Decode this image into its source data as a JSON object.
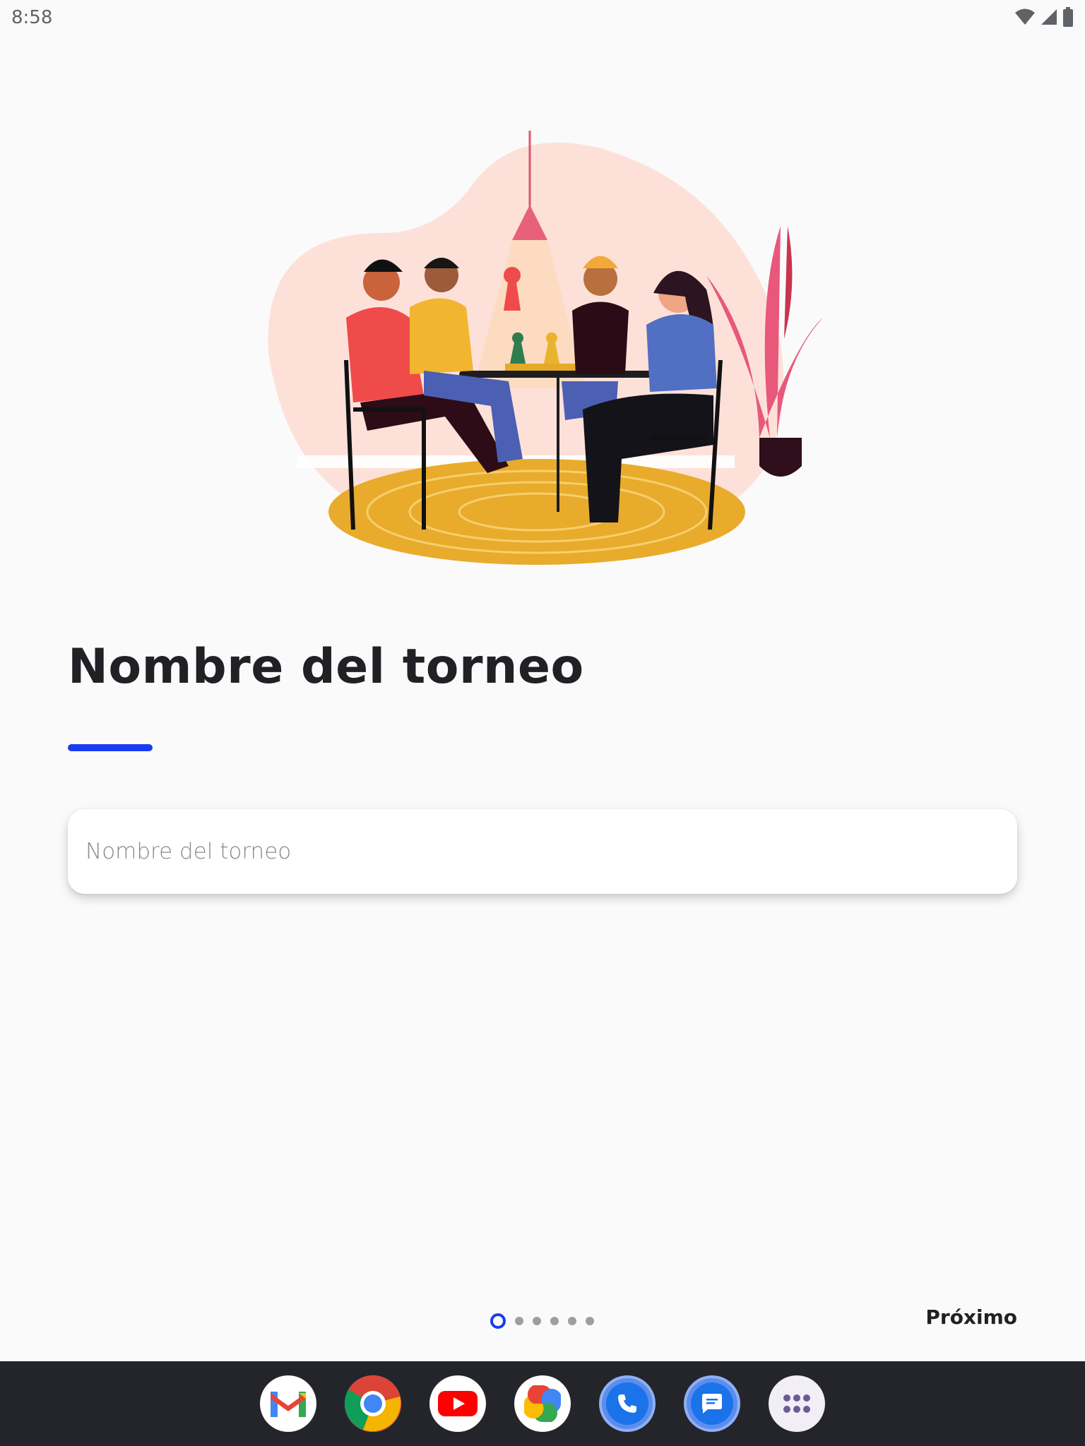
{
  "status_bar": {
    "time": "8:58",
    "icons": [
      "wifi-icon",
      "cellular-signal-icon",
      "battery-icon"
    ]
  },
  "illustration": {
    "description_icon": "people-playing-board-game-illustration"
  },
  "page": {
    "title": "Nombre del torneo",
    "accent_color": "#1a3cf0"
  },
  "input": {
    "placeholder": "Nombre del torneo",
    "value": ""
  },
  "pager": {
    "total": 6,
    "current": 1
  },
  "actions": {
    "next_label": "Próximo"
  },
  "dock": {
    "apps": [
      {
        "name": "Gmail",
        "icon": "gmail-icon"
      },
      {
        "name": "Chrome",
        "icon": "chrome-icon"
      },
      {
        "name": "YouTube",
        "icon": "youtube-icon"
      },
      {
        "name": "Photos",
        "icon": "photos-icon"
      },
      {
        "name": "Phone",
        "icon": "phone-icon"
      },
      {
        "name": "Messages",
        "icon": "messages-icon"
      },
      {
        "name": "App drawer",
        "icon": "app-drawer-icon"
      }
    ]
  }
}
